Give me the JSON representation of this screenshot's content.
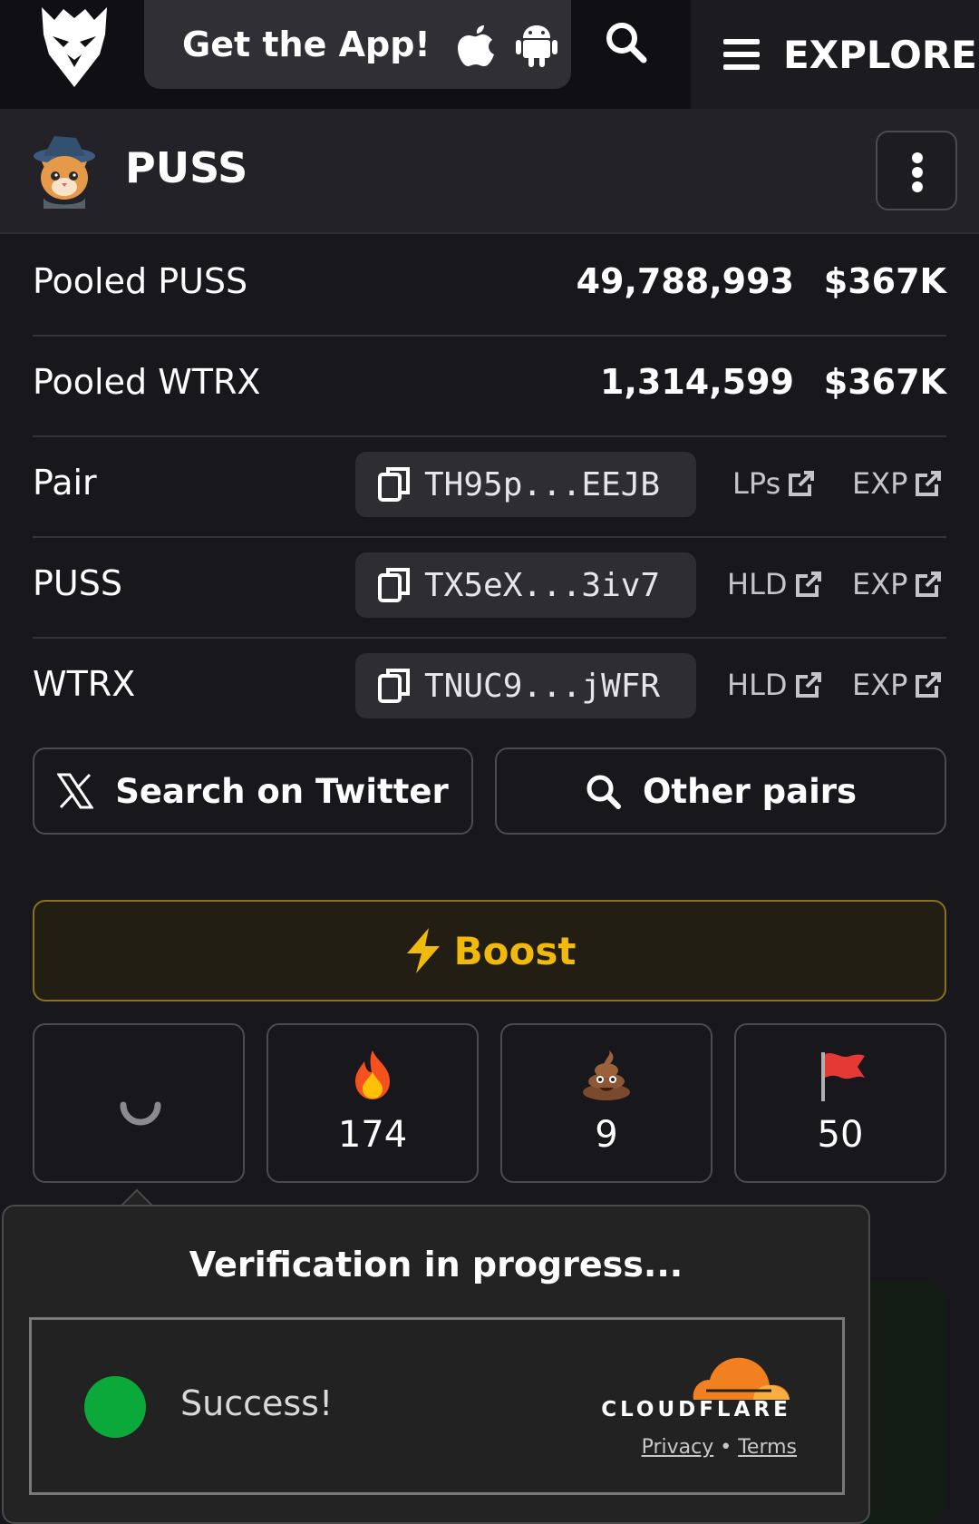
{
  "header": {
    "app_cta": "Get the App!",
    "explore_label": "EXPLORE"
  },
  "token": {
    "name": "PUSS"
  },
  "pooled": [
    {
      "label": "Pooled PUSS",
      "amount": "49,788,993",
      "usd": "$367K"
    },
    {
      "label": "Pooled WTRX",
      "amount": "1,314,599",
      "usd": "$367K"
    }
  ],
  "addresses": [
    {
      "label": "Pair",
      "code": "TH95p...EEJB",
      "link1": "LPs",
      "link2": "EXP"
    },
    {
      "label": "PUSS",
      "code": "TX5eX...3iv7",
      "link1": "HLD",
      "link2": "EXP"
    },
    {
      "label": "WTRX",
      "code": "TNUC9...jWFR",
      "link1": "HLD",
      "link2": "EXP"
    }
  ],
  "actions": {
    "twitter": "Search on Twitter",
    "other_pairs": "Other pairs",
    "boost": "Boost"
  },
  "reactions": [
    {
      "icon": "loading-spinner",
      "count": ""
    },
    {
      "icon": "fire-icon",
      "count": "174"
    },
    {
      "icon": "poop-icon",
      "count": "9"
    },
    {
      "icon": "red-flag-icon",
      "count": "50"
    }
  ],
  "verification": {
    "title": "Verification in progress...",
    "status": "Success!",
    "brand": "CLOUDFLARE",
    "privacy": "Privacy",
    "separator": "•",
    "terms": "Terms"
  },
  "colors": {
    "background": "#17171c",
    "boost_accent": "#f0b90b",
    "success_green": "#0ba83a",
    "cloudflare_orange": "#f38020"
  }
}
